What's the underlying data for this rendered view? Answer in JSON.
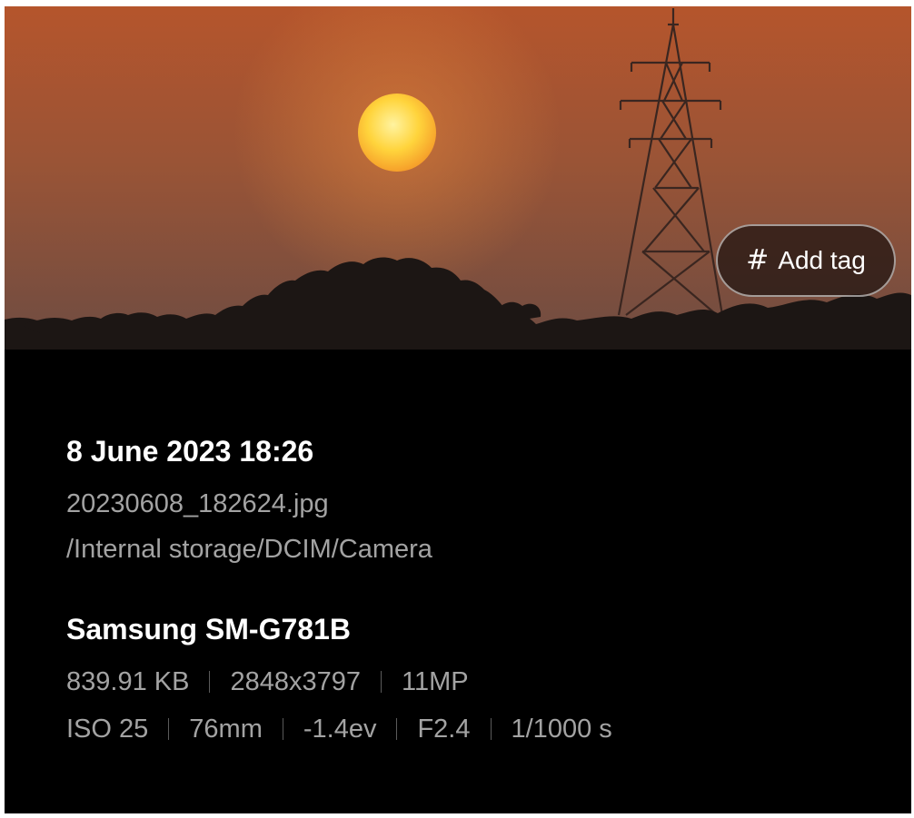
{
  "photo": {
    "subject": "sunset over trees with transmission tower",
    "colors": {
      "sky_top": "#b4542c",
      "sky_bottom": "#7a4e3c",
      "sun": "#ffd13a",
      "silhouette": "#1c1614"
    }
  },
  "tag_button": {
    "icon": "hash-icon",
    "label": "Add tag"
  },
  "details": {
    "date_time": "8 June 2023 18:26",
    "filename": "20230608_182624.jpg",
    "path": "/Internal storage/DCIM/Camera",
    "device": "Samsung SM-G781B",
    "file_specs": [
      "839.91 KB",
      "2848x3797",
      "11MP"
    ],
    "camera_specs": [
      "ISO 25",
      "76mm",
      "-1.4ev",
      "F2.4",
      "1/1000 s"
    ]
  },
  "colors": {
    "background": "#000000",
    "primary_text": "#ffffff",
    "secondary_text": "#a3a3a3",
    "separator": "#5a5a5a"
  }
}
